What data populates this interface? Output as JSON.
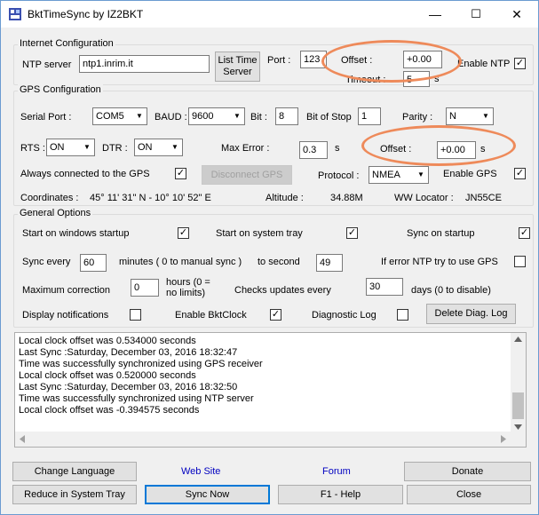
{
  "window": {
    "title": "BktTimeSync by IZ2BKT",
    "minimize": "—",
    "maximize": "☐",
    "close": "✕"
  },
  "internet": {
    "legend": "Internet Configuration",
    "ntp_label": "NTP server",
    "ntp_value": "ntp1.inrim.it",
    "list_button": "List Time Server",
    "port_label": "Port :",
    "port_value": "123",
    "offset_label": "Offset :",
    "offset_value": "+0.00",
    "offset_unit": "s",
    "timeout_label": "Timeout :",
    "timeout_value": "5",
    "timeout_unit": "s",
    "enable_ntp_label": "Enable NTP",
    "enable_ntp_checked": true
  },
  "gps": {
    "legend": "GPS Configuration",
    "serial_label": "Serial Port :",
    "serial_value": "COM5",
    "baud_label": "BAUD :",
    "baud_value": "9600",
    "bit_label": "Bit :",
    "bit_value": "8",
    "stopbit_label": "Bit of Stop",
    "stopbit_value": "1",
    "parity_label": "Parity :",
    "parity_value": "N",
    "rts_label": "RTS :",
    "rts_value": "ON",
    "dtr_label": "DTR :",
    "dtr_value": "ON",
    "maxerror_label": "Max Error :",
    "maxerror_value": "0.3",
    "maxerror_unit": "s",
    "offset_label": "Offset :",
    "offset_value": "+0.00",
    "offset_unit": "s",
    "always_connected_label": "Always connected to the GPS",
    "always_connected_checked": true,
    "disconnect_button": "Disconnect GPS",
    "protocol_label": "Protocol :",
    "protocol_value": "NMEA",
    "enable_gps_label": "Enable GPS",
    "enable_gps_checked": true,
    "coordinates_label": "Coordinates :",
    "coordinates_value": "45° 11' 31\" N - 10° 10' 52\" E",
    "altitude_label": "Altitude :",
    "altitude_value": "34.88M",
    "locator_label": "WW Locator :",
    "locator_value": "JN55CE"
  },
  "general": {
    "legend": "General Options",
    "startup_label": "Start on windows startup",
    "startup_checked": true,
    "tray_label": "Start on system tray",
    "tray_checked": true,
    "sync_startup_label": "Sync on startup",
    "sync_startup_checked": true,
    "sync_every_label": "Sync every",
    "sync_every_value": "60",
    "minutes_label": "minutes ( 0 to manual sync )",
    "to_second_label": "to second",
    "to_second_value": "49",
    "fallback_label": "If error NTP try to use GPS",
    "fallback_checked": false,
    "maxcorr_label": "Maximum correction",
    "maxcorr_value": "0",
    "hours_label": "hours (0 =",
    "hours_label2": "no limits)",
    "checks_label": "Checks updates every",
    "checks_value": "30",
    "days_label": "days (0 to disable)",
    "notifications_label": "Display notifications",
    "notifications_checked": false,
    "bktclock_label": "Enable BktClock",
    "bktclock_checked": true,
    "diaglog_label": "Diagnostic Log",
    "diaglog_checked": false,
    "delete_diag_button": "Delete Diag. Log"
  },
  "log": {
    "lines": [
      "Local clock offset was 0.534000 seconds",
      "Last Sync :Saturday, December 03, 2016 18:32:47",
      "Time was successfully synchronized using GPS receiver",
      "Local clock offset was 0.520000 seconds",
      "Last Sync :Saturday, December 03, 2016 18:32:50",
      "Time was successfully synchronized using NTP server",
      "Local clock offset was -0.394575 seconds"
    ]
  },
  "footer": {
    "change_language": "Change Language",
    "web_site": "Web Site",
    "forum": "Forum",
    "donate": "Donate",
    "reduce_tray": "Reduce in System Tray",
    "sync_now": "Sync Now",
    "help": "F1 - Help",
    "close": "Close"
  },
  "colors": {
    "highlight_oval": "#ee8a5a",
    "link": "#0000c0"
  }
}
